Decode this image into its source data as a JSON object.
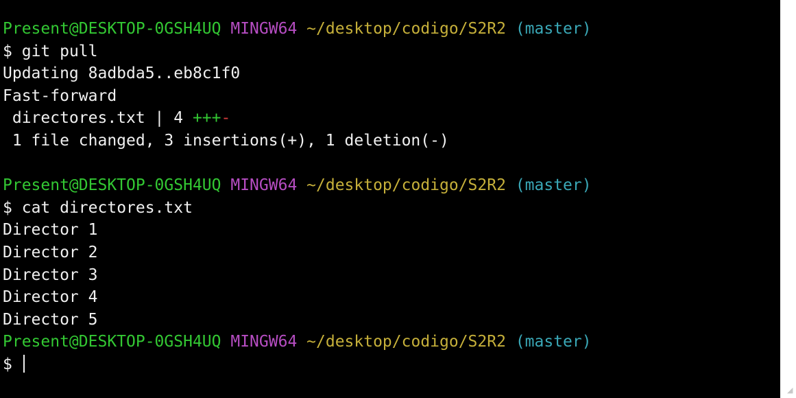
{
  "colors": {
    "background": "#000000",
    "text": "#f0f0f0",
    "user": "#33c833",
    "host": "#b64dc2",
    "path": "#c6b03a",
    "branch": "#3aa8b7",
    "insertion": "#33c833",
    "deletion": "#d33b3b"
  },
  "prompt": {
    "user_host": "Present@DESKTOP-0GSH4UQ",
    "system": "MINGW64",
    "path": "~/desktop/codigo/S2R2",
    "branch": "(master)",
    "symbol": "$"
  },
  "session": {
    "cmd1": "git pull",
    "pull_updating": "Updating 8adbda5..eb8c1f0",
    "pull_fastforward": "Fast-forward",
    "stat_file": " directores.txt | 4 ",
    "stat_plus": "+++",
    "stat_minus": "-",
    "stat_summary": " 1 file changed, 3 insertions(+), 1 deletion(-)",
    "cmd2": "cat directores.txt",
    "output": [
      "Director 1",
      "Director 2",
      "Director 3",
      "Director 4",
      "Director 5"
    ]
  }
}
